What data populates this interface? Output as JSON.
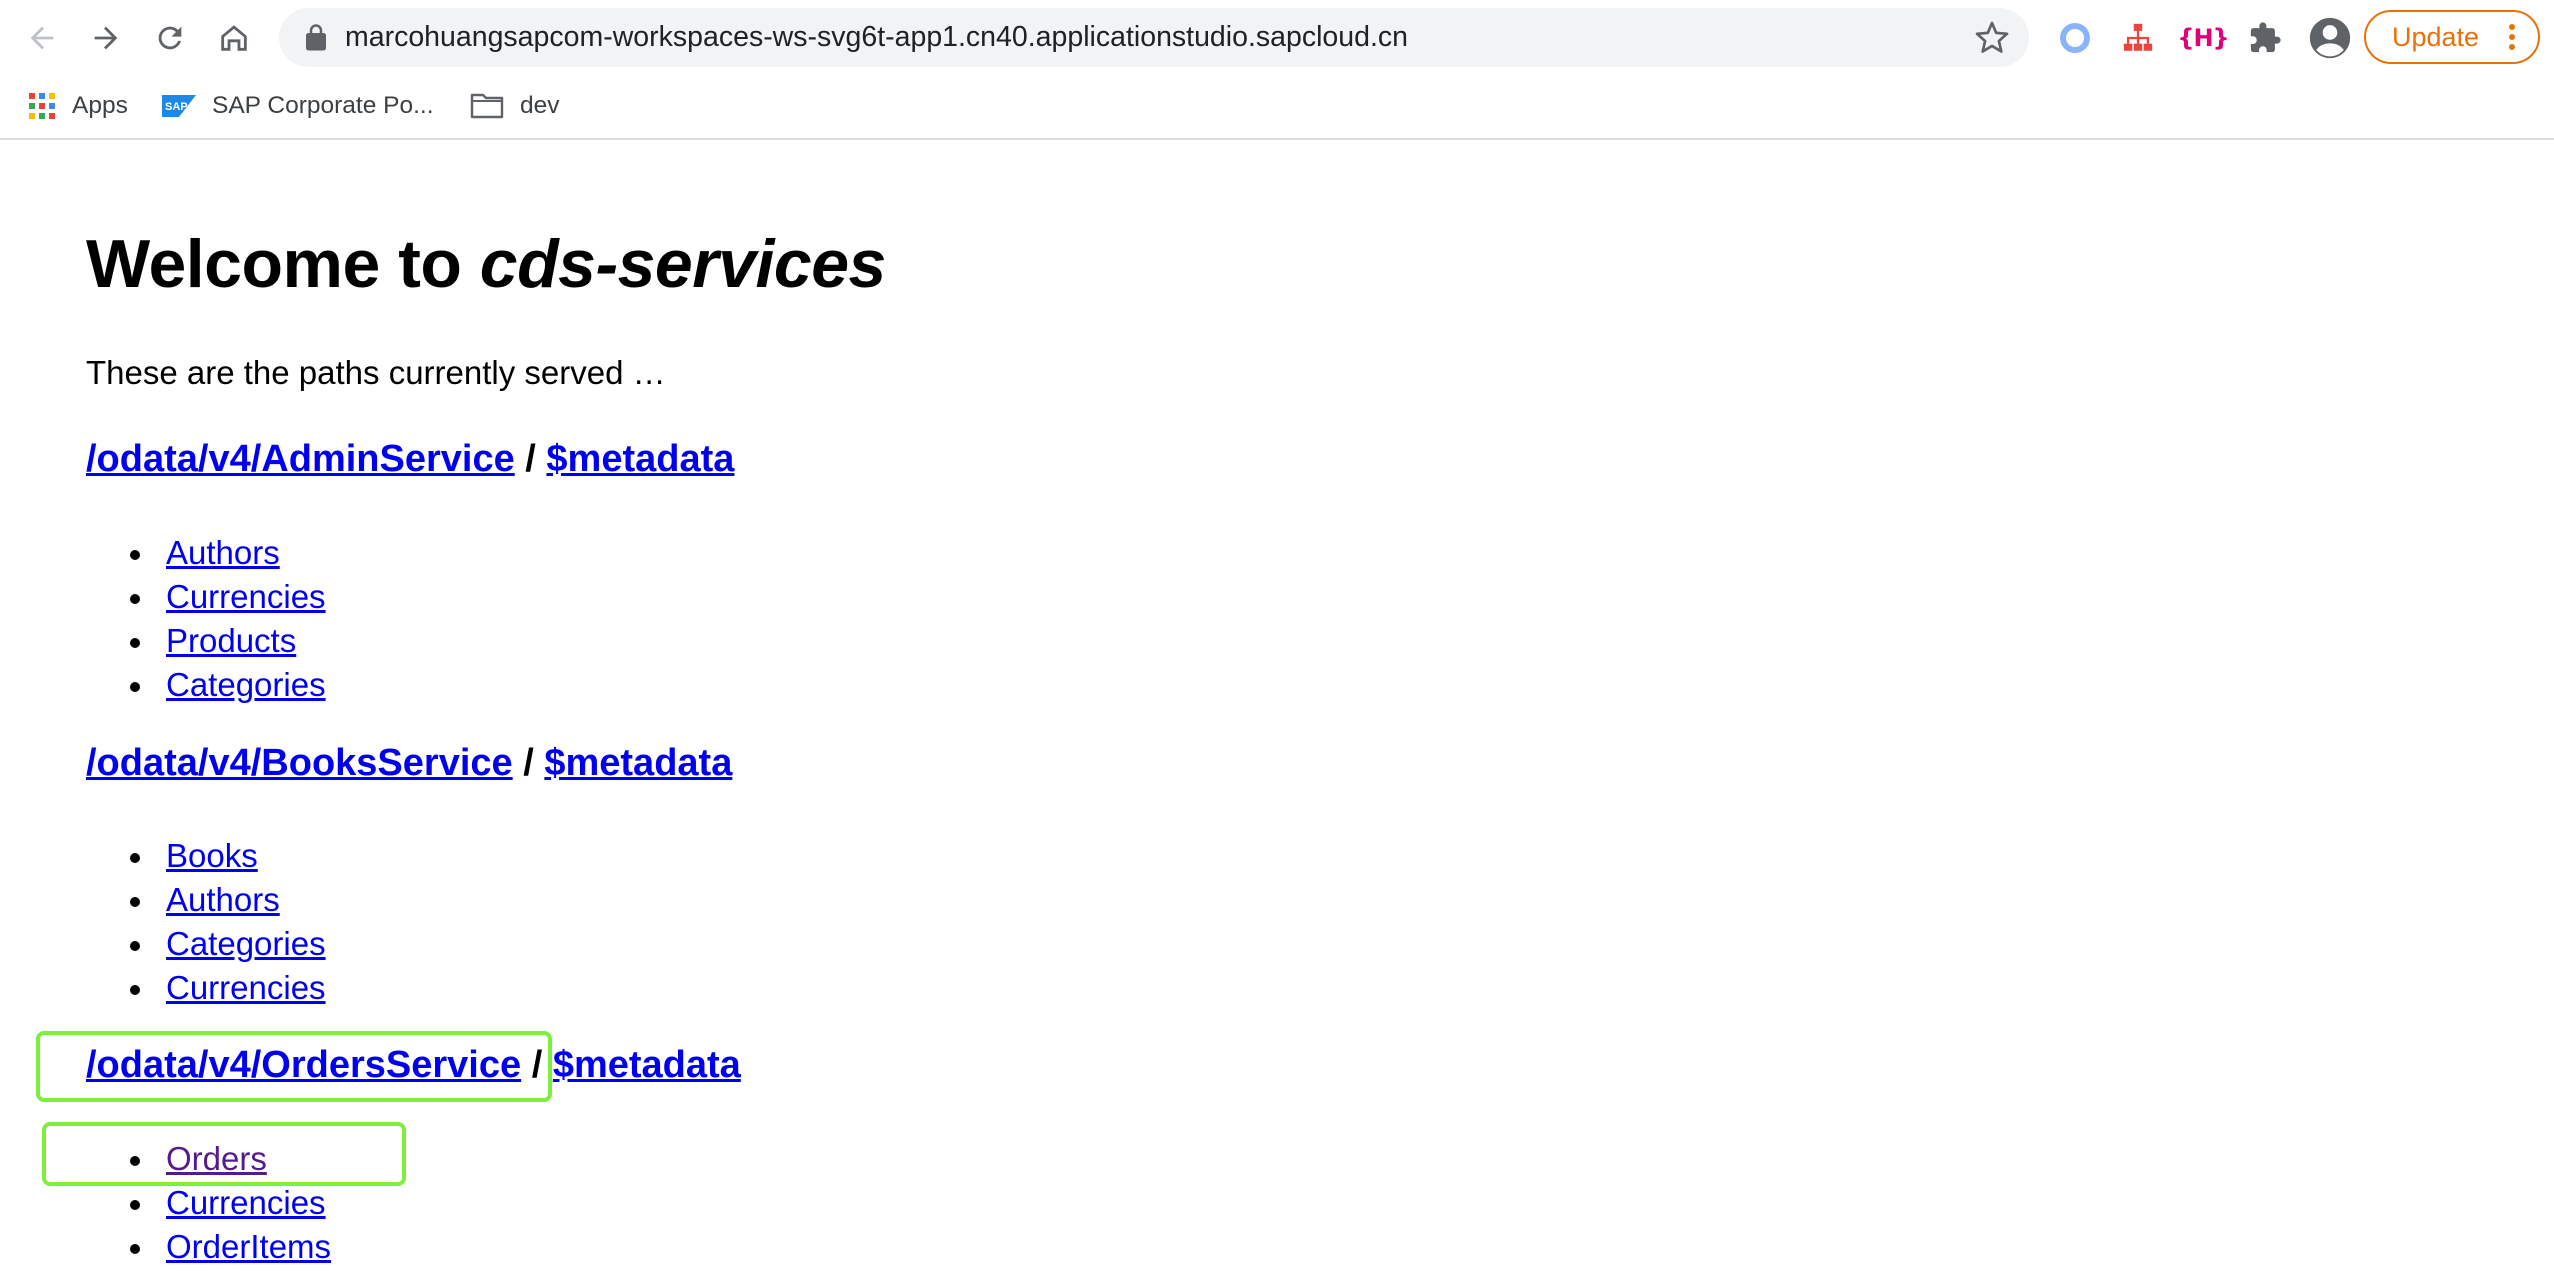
{
  "browser": {
    "url": "marcohuangsapcom-workspaces-ws-svg6t-app1.cn40.applicationstudio.sapcloud.cn",
    "ext_h_label": "{H}",
    "update_label": "Update",
    "accent_color": "#e8710a"
  },
  "bookmarks": [
    {
      "label": "Apps",
      "icon": "apps-grid-icon"
    },
    {
      "label": "SAP Corporate Po...",
      "icon": "sap-logo-icon"
    },
    {
      "label": "dev",
      "icon": "folder-icon"
    }
  ],
  "page": {
    "title_prefix": "Welcome to ",
    "title_italic": "cds-services",
    "intro": "These are the paths currently served …",
    "separator": "/",
    "services": [
      {
        "path": "/odata/v4/AdminService",
        "metadata": "$metadata",
        "entities": [
          "Authors",
          "Currencies",
          "Products",
          "Categories"
        ]
      },
      {
        "path": "/odata/v4/BooksService",
        "metadata": "$metadata",
        "entities": [
          "Books",
          "Authors",
          "Categories",
          "Currencies"
        ]
      },
      {
        "path": "/odata/v4/OrdersService",
        "metadata": "$metadata",
        "entities": [
          "Orders",
          "Currencies",
          "OrderItems"
        ]
      }
    ],
    "link_color": "#0000ee",
    "visited_color": "#551a8b",
    "highlight_color": "#7cf03c"
  }
}
